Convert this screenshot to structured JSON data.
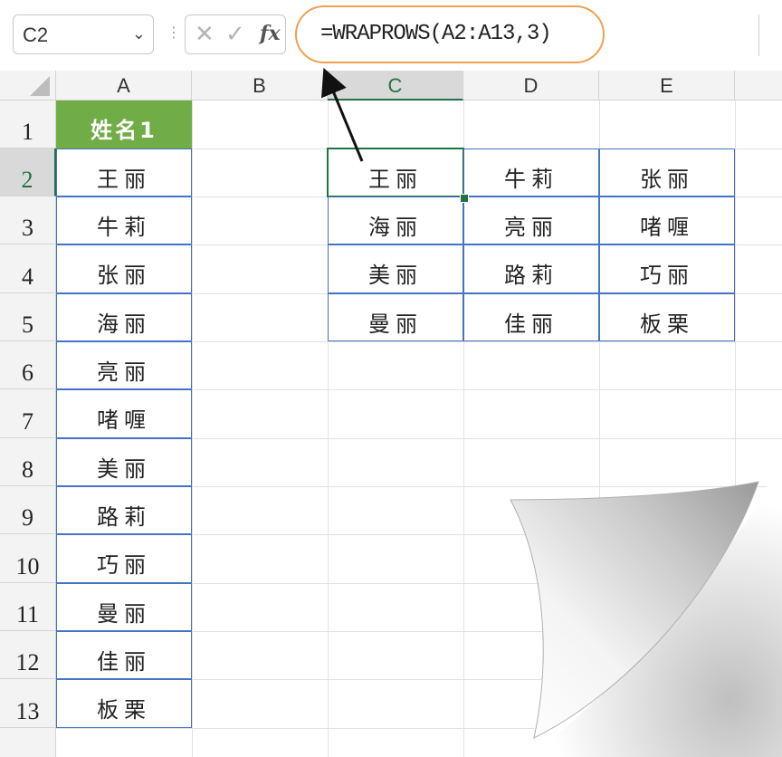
{
  "name_box": {
    "value": "C2"
  },
  "formula_bar": {
    "cancel_icon": "✕",
    "enter_icon": "✓",
    "fx_label": "fx",
    "formula": "=WRAPROWS(A2:A13,3)"
  },
  "columns": [
    "A",
    "B",
    "C",
    "D",
    "E"
  ],
  "rows": [
    "1",
    "2",
    "3",
    "4",
    "5",
    "6",
    "7",
    "8",
    "9",
    "10",
    "11",
    "12",
    "13"
  ],
  "column_a": {
    "header": "姓名1",
    "names": [
      "王丽",
      "牛莉",
      "张丽",
      "海丽",
      "亮丽",
      "啫喱",
      "美丽",
      "路莉",
      "巧丽",
      "曼丽",
      "佳丽",
      "板栗"
    ]
  },
  "result_grid": [
    [
      "王丽",
      "牛莉",
      "张丽"
    ],
    [
      "海丽",
      "亮丽",
      "啫喱"
    ],
    [
      "美丽",
      "路莉",
      "巧丽"
    ],
    [
      "曼丽",
      "佳丽",
      "板栗"
    ]
  ],
  "colors": {
    "header_fill": "#70ad47",
    "selection": "#217346",
    "table_border": "#4472c4",
    "formula_highlight": "#f0a050"
  }
}
